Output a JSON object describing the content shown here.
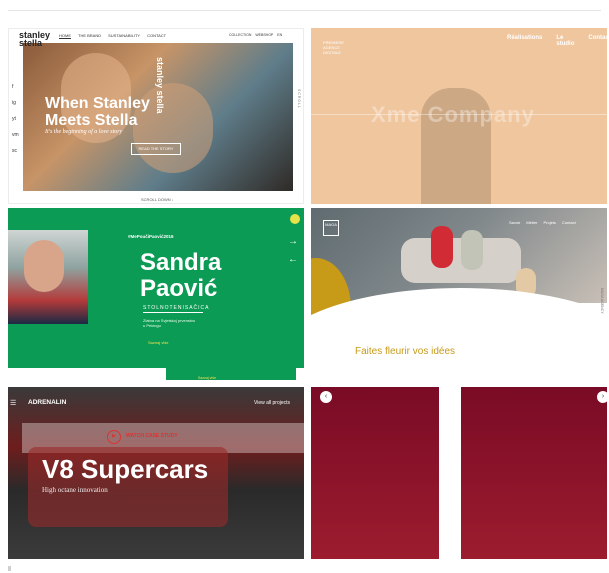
{
  "tiles": {
    "stanley": {
      "logo": "stanley stella",
      "nav": [
        "HOME",
        "THE BRAND",
        "SUSTAINABILITY",
        "CONTACT"
      ],
      "right_nav": [
        "COLLECTION",
        "WEBSHOP",
        "EN"
      ],
      "social": [
        "f",
        "ig",
        "yt",
        "vm",
        "sc"
      ],
      "title": "When Stanley Meets Stella",
      "subtitle": "It's the beginning of a love story",
      "button": "READ THE STORY",
      "side_logo": "stanley stella",
      "scroll": "SCROLL DOWN ↓",
      "vertical_text": "SCROLL"
    },
    "xme": {
      "logo": "PREMIERE AGENCE DIGITALE",
      "nav": [
        "Réalisations",
        "Le studio",
        "Contact"
      ],
      "big_text": "Xme Company"
    },
    "sandra": {
      "tag": "#MePoučiPaović2016",
      "name": "Sandra Paović",
      "subtitle": "STOLNOTENISAČICA",
      "description": "Zlatna na Svjetskoj prvenstvu u Pekingu",
      "link": "Saznaj više",
      "arrow_next": "→",
      "arrow_prev": "←",
      "bottom_link": "Saznaj više"
    },
    "maga": {
      "logo": "MAGA",
      "nav": [
        "Savoir",
        "Métier",
        "Projets",
        "Contact"
      ],
      "headline": "Faites fleurir vos idées",
      "vertical_text": "MAGA AGENCY"
    },
    "adrenalin": {
      "logo": "ADRENALIN",
      "view_all": "View all projects",
      "menu": "☰",
      "watch_label": "WATCH CASE STUDY",
      "play_icon": "▶",
      "title": "V8 Supercars",
      "subtitle": "High octane innovation"
    },
    "red": {
      "left_btn": "‹",
      "right_btn": "›"
    }
  }
}
